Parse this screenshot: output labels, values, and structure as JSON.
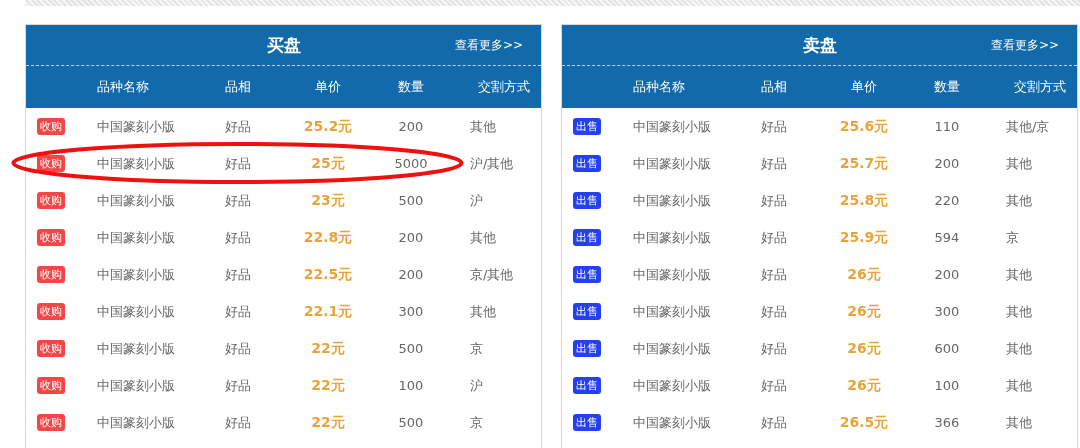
{
  "panels": [
    {
      "kind": "buy",
      "title": "买盘",
      "more_link": "查看更多>>",
      "columns": [
        "品种名称",
        "品相",
        "单价",
        "数量",
        "交割方式"
      ],
      "rows": [
        {
          "badge": "收购",
          "name": "中国篆刻小版",
          "quality": "好品",
          "price": "25.2元",
          "quantity": "200",
          "delivery": "其他",
          "circled": false
        },
        {
          "badge": "收购",
          "name": "中国篆刻小版",
          "quality": "好品",
          "price": "25元",
          "quantity": "5000",
          "delivery": "沪/其他",
          "circled": true
        },
        {
          "badge": "收购",
          "name": "中国篆刻小版",
          "quality": "好品",
          "price": "23元",
          "quantity": "500",
          "delivery": "沪",
          "circled": false
        },
        {
          "badge": "收购",
          "name": "中国篆刻小版",
          "quality": "好品",
          "price": "22.8元",
          "quantity": "200",
          "delivery": "其他",
          "circled": false
        },
        {
          "badge": "收购",
          "name": "中国篆刻小版",
          "quality": "好品",
          "price": "22.5元",
          "quantity": "200",
          "delivery": "京/其他",
          "circled": false
        },
        {
          "badge": "收购",
          "name": "中国篆刻小版",
          "quality": "好品",
          "price": "22.1元",
          "quantity": "300",
          "delivery": "其他",
          "circled": false
        },
        {
          "badge": "收购",
          "name": "中国篆刻小版",
          "quality": "好品",
          "price": "22元",
          "quantity": "500",
          "delivery": "京",
          "circled": false
        },
        {
          "badge": "收购",
          "name": "中国篆刻小版",
          "quality": "好品",
          "price": "22元",
          "quantity": "100",
          "delivery": "沪",
          "circled": false
        },
        {
          "badge": "收购",
          "name": "中国篆刻小版",
          "quality": "好品",
          "price": "22元",
          "quantity": "500",
          "delivery": "京",
          "circled": false
        }
      ]
    },
    {
      "kind": "sell",
      "title": "卖盘",
      "more_link": "查看更多>>",
      "columns": [
        "品种名称",
        "品相",
        "单价",
        "数量",
        "交割方式"
      ],
      "rows": [
        {
          "badge": "出售",
          "name": "中国篆刻小版",
          "quality": "好品",
          "price": "25.6元",
          "quantity": "110",
          "delivery": "其他/京",
          "circled": false
        },
        {
          "badge": "出售",
          "name": "中国篆刻小版",
          "quality": "好品",
          "price": "25.7元",
          "quantity": "200",
          "delivery": "其他",
          "circled": false
        },
        {
          "badge": "出售",
          "name": "中国篆刻小版",
          "quality": "好品",
          "price": "25.8元",
          "quantity": "220",
          "delivery": "其他",
          "circled": false
        },
        {
          "badge": "出售",
          "name": "中国篆刻小版",
          "quality": "好品",
          "price": "25.9元",
          "quantity": "594",
          "delivery": "京",
          "circled": false
        },
        {
          "badge": "出售",
          "name": "中国篆刻小版",
          "quality": "好品",
          "price": "26元",
          "quantity": "200",
          "delivery": "其他",
          "circled": false
        },
        {
          "badge": "出售",
          "name": "中国篆刻小版",
          "quality": "好品",
          "price": "26元",
          "quantity": "300",
          "delivery": "其他",
          "circled": false
        },
        {
          "badge": "出售",
          "name": "中国篆刻小版",
          "quality": "好品",
          "price": "26元",
          "quantity": "600",
          "delivery": "其他",
          "circled": false
        },
        {
          "badge": "出售",
          "name": "中国篆刻小版",
          "quality": "好品",
          "price": "26元",
          "quantity": "100",
          "delivery": "其他",
          "circled": false
        },
        {
          "badge": "出售",
          "name": "中国篆刻小版",
          "quality": "好品",
          "price": "26.5元",
          "quantity": "366",
          "delivery": "其他",
          "circled": false
        }
      ]
    }
  ]
}
